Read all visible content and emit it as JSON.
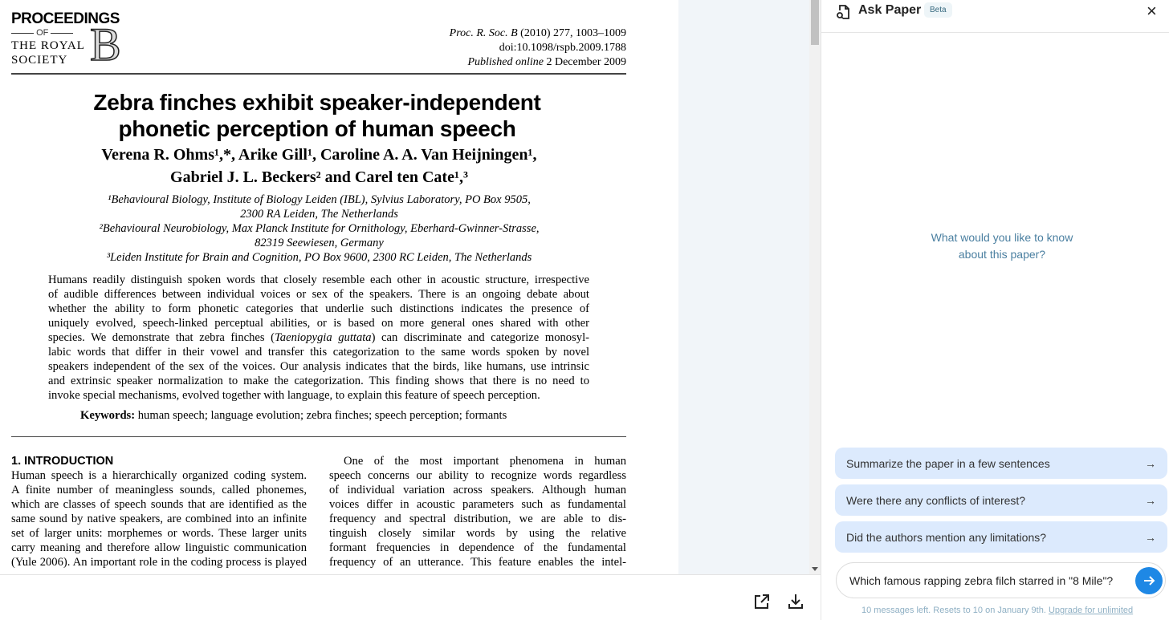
{
  "pdf": {
    "logo": {
      "line1": "PROCEEDINGS",
      "of": "OF",
      "line2": "THE ROYAL",
      "line3": "SOCIETY",
      "letter": "B"
    },
    "citation": {
      "journal": "Proc. R. Soc. B",
      "rest": " (2010) 277, 1003–1009",
      "doi": "doi:10.1098/rspb.2009.1788",
      "published_label": "Published online",
      "published_date": " 2 December 2009"
    },
    "title_lines": [
      "Zebra finches exhibit speaker-independent",
      "phonetic perception of human speech"
    ],
    "author_lines": [
      "Verena R. Ohms¹,*, Arike Gill¹, Caroline A. A. Van Heijningen¹,",
      "Gabriel J. L. Beckers² and Carel ten Cate¹,³"
    ],
    "affiliation_lines": [
      "¹Behavioural Biology, Institute of Biology Leiden (IBL), Sylvius Laboratory, PO Box 9505,",
      "2300 RA Leiden, The Netherlands",
      "²Behavioural Neurobiology, Max Planck Institute for Ornithology, Eberhard-Gwinner-Strasse,",
      "82319 Seewiesen, Germany",
      "³Leiden Institute for Brain and Cognition, PO Box 9600, 2300 RC Leiden, The Netherlands"
    ],
    "abstract_lines": [
      "Humans readily distinguish spoken words that closely resemble each other in acoustic structure, irrespective",
      "of audible differences between individual voices or sex of the speakers. There is an ongoing debate about",
      "whether the ability to form phonetic categories that underlie such distinctions indicates the presence of",
      "uniquely evolved, speech-linked perceptual abilities, or is based on more general ones shared with other",
      "species. We demonstrate that zebra finches (Taeniopygia guttata) can discriminate and categorize monosyl-",
      "labic words that differ in their vowel and transfer this categorization to the same words spoken by novel",
      "speakers independent of the sex of the voices. Our analysis indicates that the birds, like humans, use intrinsic",
      "and extrinsic speaker normalization to make the categorization. This finding shows that there is no need to",
      "invoke special mechanisms, evolved together with language, to explain this feature of speech perception."
    ],
    "keywords_label": "Keywords:",
    "keywords": " human speech; language evolution; zebra finches; speech perception; formants",
    "section_heading": "1. INTRODUCTION",
    "col1_lines": [
      "Human speech is a hierarchically organized coding system.",
      "A finite number of meaningless sounds, called phonemes,",
      "which are classes of speech sounds that are identified as the",
      "same sound by native speakers, are combined into an infinite",
      "set of larger units: morphemes or words. These larger units",
      "carry meaning and therefore allow linguistic communication",
      "(Yule 2006). An important role in the coding process is played"
    ],
    "col2_lines": [
      "One of the most important phenomena in human",
      "speech concerns our ability to recognize words regardless",
      "of individual variation across speakers. Although human",
      "voices differ in acoustic parameters such as fundamental",
      "frequency and spectral distribution, we are able to dis-",
      "tinguish closely similar words by using the relative",
      "formant frequencies in dependence of the fundamental",
      "frequency of an utterance. This feature enables the intel-"
    ]
  },
  "toolbar": {
    "icons": [
      "open-external-icon",
      "download-icon"
    ]
  },
  "panel": {
    "title": "Ask Paper",
    "badge": "Beta",
    "prompt": "What would you like to know about this paper?",
    "suggestions": [
      "Summarize the paper in a few sentences",
      "Were there any conflicts of interest?",
      "Did the authors mention any limitations?"
    ],
    "input_value": "Which famous rapping zebra filch starred in \"8 Mile\"?",
    "footer": "10 messages left. Resets to 10 on January 9th. ",
    "upgrade_link": "Upgrade for unlimited",
    "colors": {
      "accent": "#1e88e5",
      "suggestion_bg": "#dceafd"
    }
  }
}
